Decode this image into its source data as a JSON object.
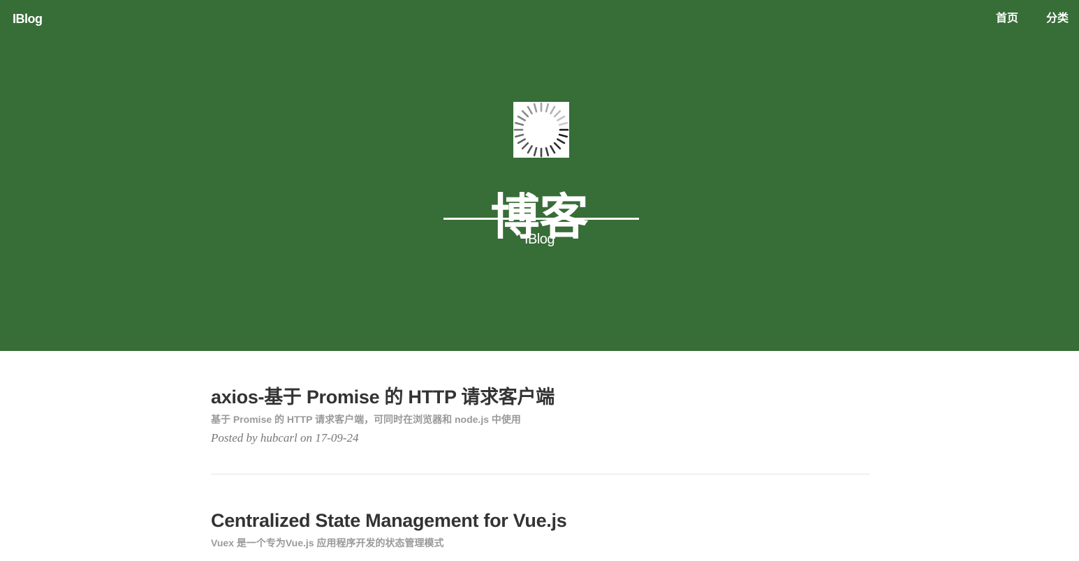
{
  "navbar": {
    "brand": "IBlog",
    "links": [
      {
        "label": "首页"
      },
      {
        "label": "分类"
      }
    ]
  },
  "hero": {
    "avatar_icon": "loading-spinner-icon",
    "title": "博客",
    "subtitle": "IBlog",
    "background_color": "#376d37"
  },
  "posts": [
    {
      "title": "axios-基于 Promise 的 HTTP 请求客户端",
      "subtitle": "基于 Promise 的 HTTP 请求客户端，可同时在浏览器和 node.js 中使用",
      "meta": "Posted by hubcarl on 17-09-24"
    },
    {
      "title": "Centralized State Management for Vue.js",
      "subtitle": "Vuex 是一个专为Vue.js 应用程序开发的状态管理模式"
    }
  ]
}
